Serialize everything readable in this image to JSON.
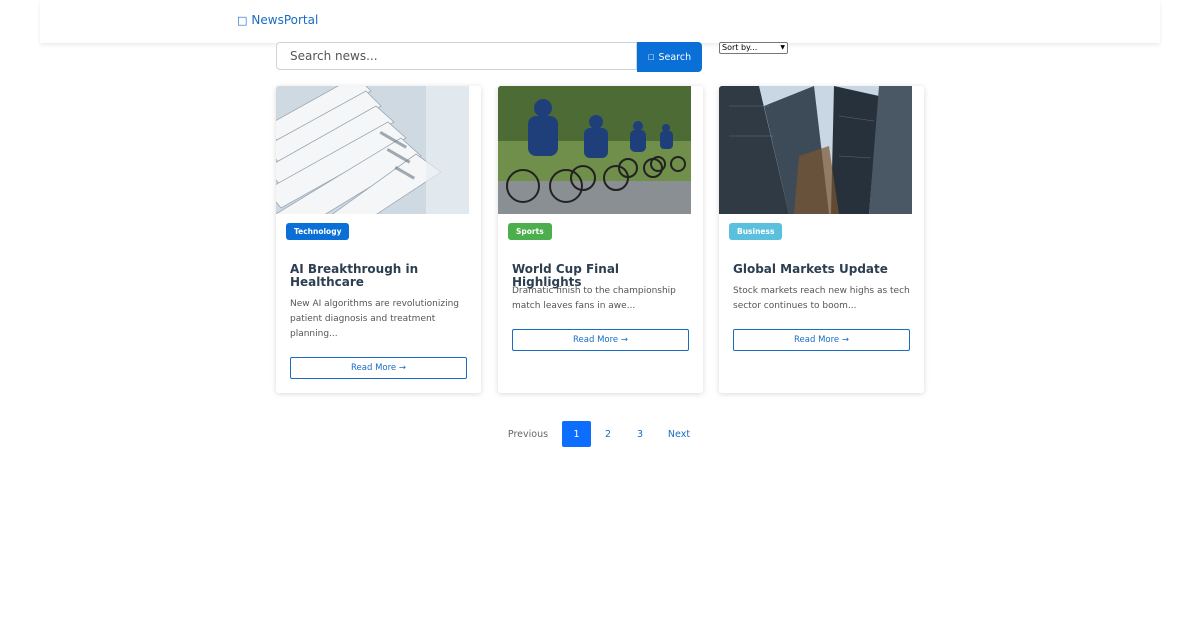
{
  "brand": {
    "logo_icon": "newspaper-icon",
    "name": "NewsPortal",
    "color": "#1a6cc2"
  },
  "search": {
    "placeholder": "Search news...",
    "button_label": "Search",
    "button_icon": "search-icon",
    "button_color": "#0a6fd6"
  },
  "sort": {
    "selected": "Sort by..."
  },
  "articles": [
    {
      "category": "Technology",
      "category_color": "#0a6fd6",
      "title": "AI Breakthrough in Healthcare",
      "excerpt": "New AI algorithms are revolutionizing patient diagnosis and treatment planning...",
      "read_more": "Read More →",
      "image": "newspapers-photo"
    },
    {
      "category": "Sports",
      "category_color": "#4cae4c",
      "title": "World Cup Final Highlights",
      "excerpt": "Dramatic finish to the championship match leaves fans in awe...",
      "read_more": "Read More →",
      "image": "cyclists-photo"
    },
    {
      "category": "Business",
      "category_color": "#5bc0de",
      "title": "Global Markets Update",
      "excerpt": "Stock markets reach new highs as tech sector continues to boom...",
      "read_more": "Read More →",
      "image": "skyscrapers-photo"
    }
  ],
  "pagination": {
    "previous": "Previous",
    "pages": [
      "1",
      "2",
      "3"
    ],
    "current": "1",
    "next": "Next",
    "active_color": "#0d6efd"
  }
}
